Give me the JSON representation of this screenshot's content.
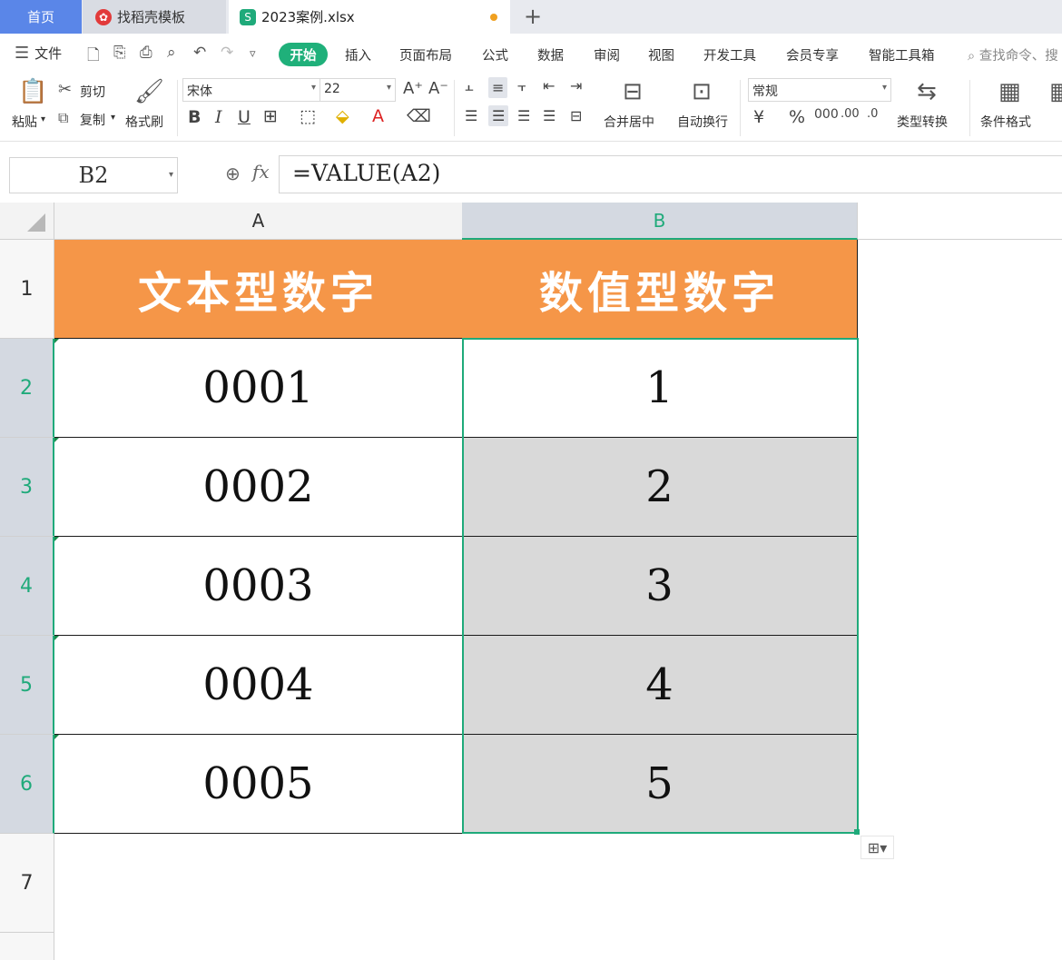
{
  "tabs": {
    "home": "首页",
    "template": "找稻壳模板",
    "file": "2023案例.xlsx",
    "add": "+"
  },
  "menu": {
    "file": "文件",
    "start": "开始",
    "items": [
      "插入",
      "页面布局",
      "公式",
      "数据",
      "审阅",
      "视图",
      "开发工具",
      "会员专享",
      "智能工具箱"
    ],
    "search": "查找命令、搜"
  },
  "ribbon": {
    "paste": "粘贴",
    "cut": "剪切",
    "copy": "复制",
    "format_painter": "格式刷",
    "font_name": "宋体",
    "font_size": "22",
    "merge_center": "合并居中",
    "wrap_text": "自动换行",
    "number_format": "常规",
    "type_convert": "类型转换",
    "conditional_format": "条件格式"
  },
  "formula_bar": {
    "name_box": "B2",
    "formula": "=VALUE(A2)"
  },
  "columns": [
    "A",
    "B"
  ],
  "rows": [
    "1",
    "2",
    "3",
    "4",
    "5",
    "6",
    "7"
  ],
  "table": {
    "header_a": "文本型数字",
    "header_b": "数值型数字",
    "text_numbers": [
      "0001",
      "0002",
      "0003",
      "0004",
      "0005"
    ],
    "numeric_values": [
      "1",
      "2",
      "3",
      "4",
      "5"
    ]
  },
  "colors": {
    "accent": "#1faa7a",
    "header_fill": "#f59648",
    "value_fill": "#d9d9d9",
    "home_tab": "#5a86e8"
  }
}
